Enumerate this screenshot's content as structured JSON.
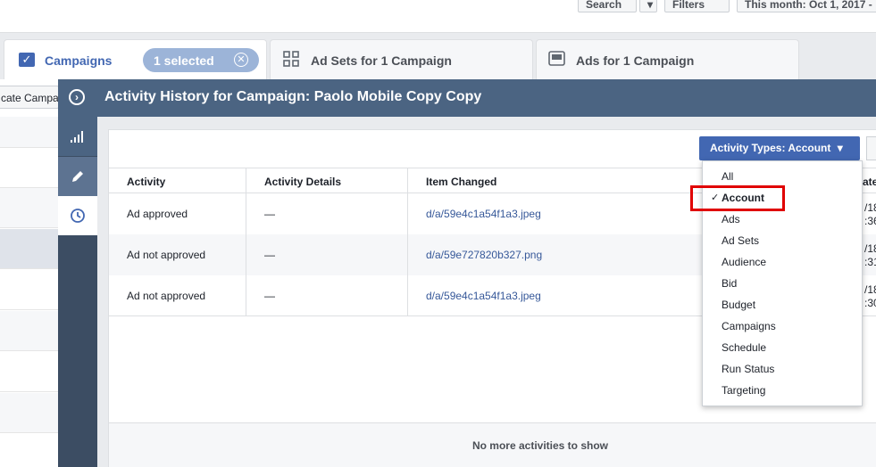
{
  "toolbar": {
    "search_label": "Search",
    "filters_label": "Filters",
    "date_label": "This month: Oct 1, 2017 -"
  },
  "tabs": {
    "campaigns": "Campaigns",
    "selected_badge": "1 selected",
    "adsets": "Ad Sets for 1 Campaign",
    "ads": "Ads for 1 Campaign"
  },
  "background": {
    "duplicate_button": "cate Campa"
  },
  "panel": {
    "title": "Activity History for Campaign: Paolo Mobile Copy Copy",
    "side_items": [
      "chart-icon",
      "pencil-icon",
      "clock-icon"
    ]
  },
  "table": {
    "headers": [
      "Activity",
      "Activity Details",
      "Item Changed",
      "ate"
    ],
    "rows": [
      {
        "activity": "Ad approved",
        "details": "—",
        "item": "d/a/59e4c1a54f1a3.jpeg",
        "date1": "/18",
        "date2": ":36"
      },
      {
        "activity": "Ad not approved",
        "details": "—",
        "item": "d/a/59e727820b327.png",
        "date1": "/18",
        "date2": ":31"
      },
      {
        "activity": "Ad not approved",
        "details": "—",
        "item": "d/a/59e4c1a54f1a3.jpeg",
        "date1": "/18",
        "date2": ":30"
      }
    ],
    "footer": "No more activities to show"
  },
  "activity_types": {
    "button_label": "Activity Types: Account",
    "selected": "Account",
    "options": [
      "All",
      "Account",
      "Ads",
      "Ad Sets",
      "Audience",
      "Bid",
      "Budget",
      "Campaigns",
      "Schedule",
      "Run Status",
      "Targeting"
    ]
  },
  "colors": {
    "header_blue": "#4b6482",
    "sidebar": "#3c4d63",
    "button_blue": "#4267b2",
    "link": "#365899",
    "highlight": "#e00000"
  }
}
